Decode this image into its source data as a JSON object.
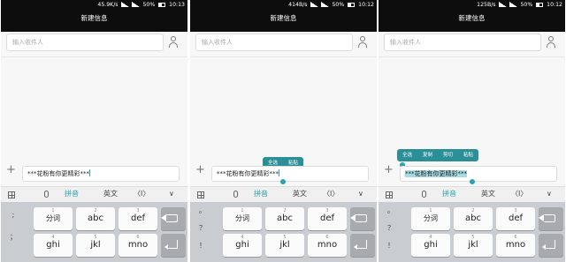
{
  "screens": [
    {
      "status_left": "",
      "net_speed": "45.9K/s",
      "battery": "50%",
      "time": "10:13",
      "title": "新建信息",
      "recipient_placeholder": "输入收件人",
      "message_text": "***花粉有你更精彩***",
      "context_menu": []
    },
    {
      "status_left": "",
      "net_speed": "414B/s",
      "battery": "50%",
      "time": "10:12",
      "title": "新建信息",
      "recipient_placeholder": "输入收件人",
      "message_text": "***花粉有你更精彩***",
      "context_menu": [
        "全选",
        "粘贴"
      ]
    },
    {
      "status_left": "",
      "net_speed": "125B/s",
      "battery": "50%",
      "time": "10:12",
      "title": "新建信息",
      "recipient_placeholder": "输入收件人",
      "message_text": "***花粉有你更精彩***",
      "context_menu": [
        "全选",
        "复制",
        "剪切",
        "粘贴"
      ]
    }
  ],
  "add_label": "+",
  "keyboard": {
    "toolbar": {
      "mode_pinyin": "拼音",
      "mode_english": "英文",
      "cursor_move": "〈I〉",
      "collapse": "∨"
    },
    "punct": [
      ";",
      "。",
      "；",
      "？",
      "！"
    ],
    "keys": [
      {
        "label": "分词",
        "num": "1"
      },
      {
        "label": "abc",
        "num": "2"
      },
      {
        "label": "def",
        "num": "3"
      },
      {
        "label": "ghi",
        "num": "4"
      },
      {
        "label": "jkl",
        "num": "5"
      },
      {
        "label": "mno",
        "num": "6"
      }
    ]
  }
}
